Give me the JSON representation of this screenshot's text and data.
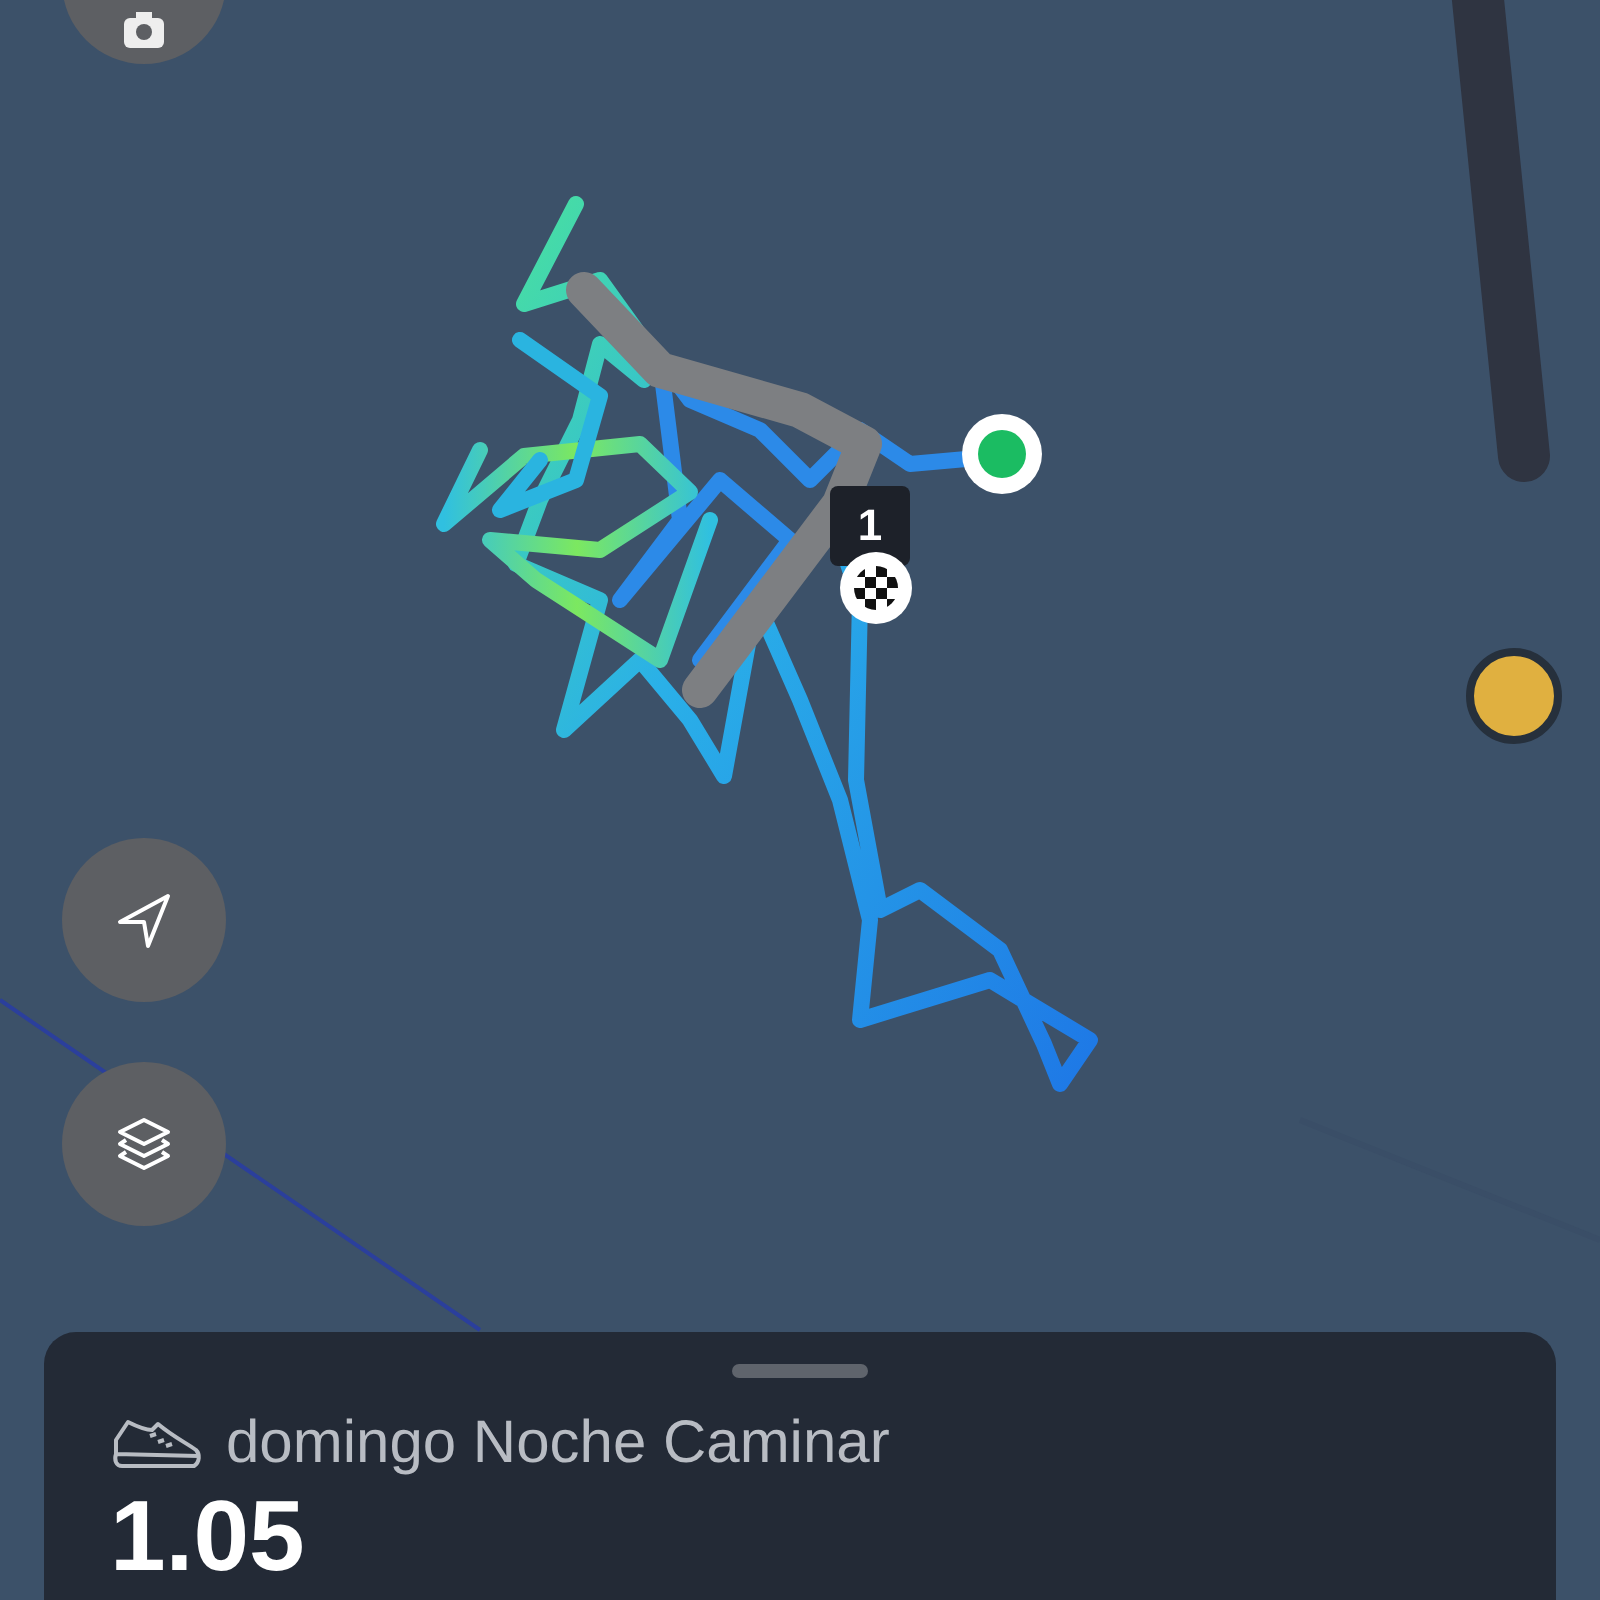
{
  "route": {
    "lap_label": "1"
  },
  "controls": [
    {
      "kind": "camera"
    },
    {
      "kind": "locate"
    },
    {
      "kind": "layers"
    }
  ],
  "activity": {
    "title": "domingo Noche Caminar",
    "distance": "1.05"
  }
}
